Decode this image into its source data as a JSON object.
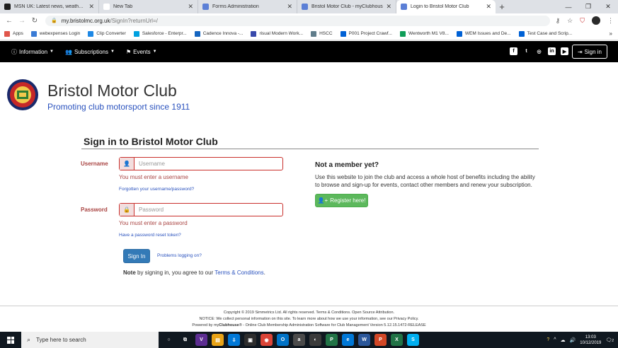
{
  "browser": {
    "tabs": [
      {
        "label": "MSN UK: Latest news, weather, H",
        "color": "#1e1e1e",
        "active": false
      },
      {
        "label": "New Tab",
        "color": "#ffffff",
        "active": false
      },
      {
        "label": "Forms Administration",
        "color": "#5b7fd6",
        "active": false
      },
      {
        "label": "Bristol Motor Club - myClubhous",
        "color": "#5b7fd6",
        "active": false
      },
      {
        "label": "Login to Bristol Motor Club",
        "color": "#5b7fd6",
        "active": true
      }
    ],
    "new_tab_symbol": "+",
    "window_controls": {
      "minimize": "—",
      "restore": "❐",
      "close": "✕"
    },
    "url_host": "my.bristolmc.org.uk",
    "url_path": "/SignIn?returnUrl=/",
    "bookmarks": [
      {
        "label": "Apps",
        "color": "#e0564b"
      },
      {
        "label": "webexpenses Login",
        "color": "#3a7bd5"
      },
      {
        "label": "Clip Converter",
        "color": "#1e88e5"
      },
      {
        "label": "Salesforce - Enterpr...",
        "color": "#00a1e0"
      },
      {
        "label": "Cadence Innova -...",
        "color": "#1565c0"
      },
      {
        "label": "risual Modern Work...",
        "color": "#3949ab"
      },
      {
        "label": "HSCC",
        "color": "#607d8b"
      },
      {
        "label": "P001 Project Crawf...",
        "color": "#0061d5"
      },
      {
        "label": "Wentworth M1 V8...",
        "color": "#0f9d58"
      },
      {
        "label": "WEM Issues and De...",
        "color": "#0061d5"
      },
      {
        "label": "Test Case and Scrip...",
        "color": "#0061d5"
      }
    ],
    "bookmarks_more": "»"
  },
  "site_nav": {
    "items": [
      {
        "icon": "ⓘ",
        "label": "Information"
      },
      {
        "icon": "👥",
        "label": "Subscriptions"
      },
      {
        "icon": "⚑",
        "label": "Events"
      }
    ],
    "social": [
      "f",
      "t",
      "◎",
      "in",
      "▶"
    ],
    "signin_label": "Sign in"
  },
  "brand": {
    "title": "Bristol Motor Club",
    "subtitle": "Promoting club motorsport since 1911"
  },
  "signin_panel": {
    "title": "Sign in to Bristol Motor Club",
    "username_label": "Username",
    "username_placeholder": "Username",
    "username_error": "You must enter a username",
    "forgot_link": "Forgotten your username/password?",
    "password_label": "Password",
    "password_placeholder": "Password",
    "password_error": "You must enter a password",
    "reset_link": "Have a password reset token?",
    "signin_button": "Sign In",
    "problems_link": "Problems logging on?",
    "note_bold": "Note",
    "note_text": " by signing in, you agree to our ",
    "note_link": "Terms & Conditions",
    "note_end": "."
  },
  "not_member": {
    "title": "Not a member yet?",
    "text": "Use this website to join the club and access a whole host of benefits including the ability to browse and sign-up for events, contact other members and renew your subscription.",
    "register_button": "Register here!"
  },
  "footer": {
    "line1": "Copyright © 2019 Simmetrics Ltd. All rights reserved. Terms & Conditions. Open Source Attribution.",
    "line2": "NOTICE: We collect personal information on this site. To learn more about how we use your information, see our Privacy Policy.",
    "line3_pre": "Powered by my",
    "line3_bold": "Clubhouse",
    "line3_post": "® - Online Club Membership Administration Software for Club Management Version 5.12.15.1472-RELEASE"
  },
  "taskbar": {
    "search_placeholder": "Type here to search",
    "apps": [
      {
        "label": "○",
        "color": "#101820"
      },
      {
        "label": "⧉",
        "color": "#101820"
      },
      {
        "label": "V",
        "color": "#5c2d91"
      },
      {
        "label": "▤",
        "color": "#e8a317"
      },
      {
        "label": "⇩",
        "color": "#0078d7"
      },
      {
        "label": "▣",
        "color": "#2d2d2d"
      },
      {
        "label": "◉",
        "color": "#db4437"
      },
      {
        "label": "O",
        "color": "#0072c6"
      },
      {
        "label": "a",
        "color": "#4a4a4a"
      },
      {
        "label": "◐",
        "color": "#3a3a3a"
      },
      {
        "label": "P",
        "color": "#217346"
      },
      {
        "label": "e",
        "color": "#0078d7"
      },
      {
        "label": "W",
        "color": "#2b579a"
      },
      {
        "label": "P",
        "color": "#d24726"
      },
      {
        "label": "X",
        "color": "#217346"
      },
      {
        "label": "S",
        "color": "#00aff0"
      }
    ],
    "time": "13:03",
    "date": "10/12/2019",
    "notifications": "2"
  }
}
